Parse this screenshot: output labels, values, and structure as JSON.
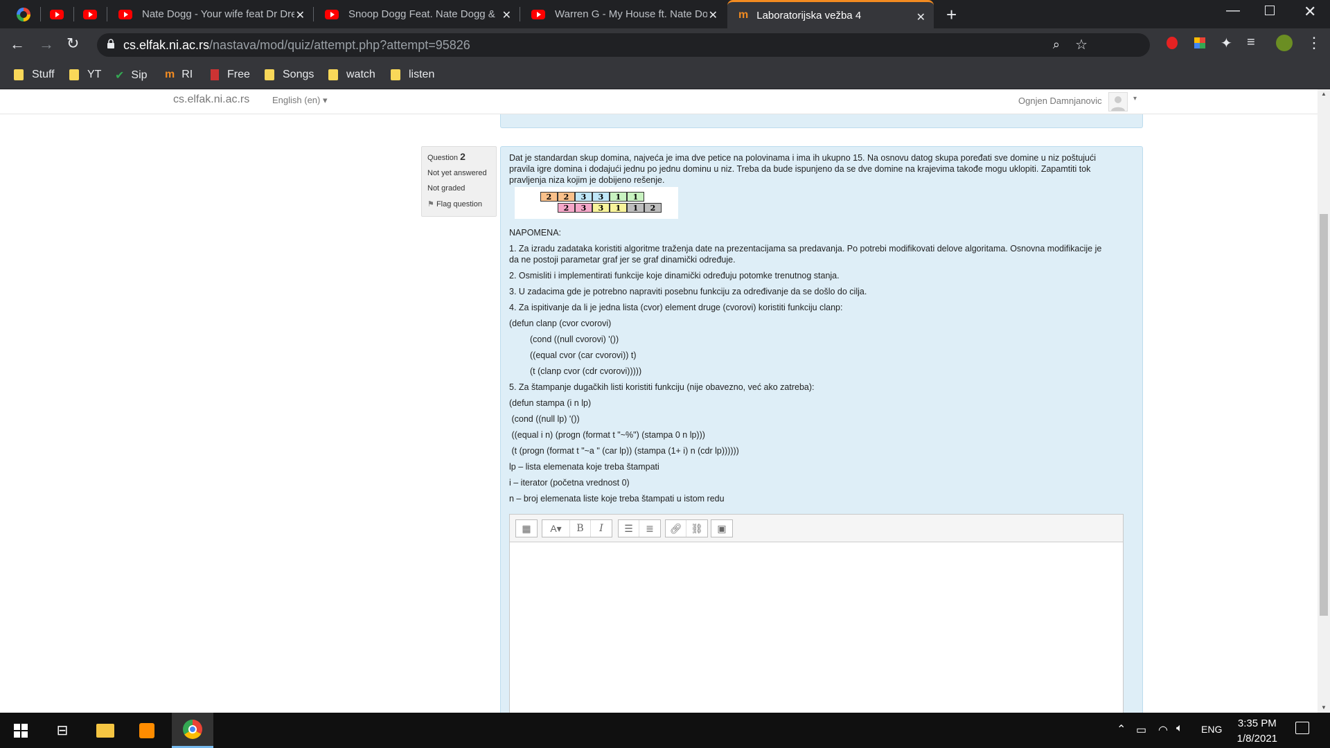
{
  "browser": {
    "tabs": [
      {
        "title": "Nate Dogg - Your wife feat Dr Dre"
      },
      {
        "title": "Snoop Dogg Feat. Nate Dogg & "
      },
      {
        "title": "Warren G - My House ft. Nate Dogg"
      },
      {
        "title": "Laboratorijska vežba 4",
        "active": true
      }
    ],
    "new_tab": "+",
    "url_domain": "cs.elfak.ni.ac.rs",
    "url_path": "/nastava/mod/quiz/attempt.php?attempt=95826",
    "bookmarks": [
      "Stuff",
      "YT",
      "Sip",
      "RI",
      "Free",
      "Songs",
      "watch",
      "listen"
    ]
  },
  "site": {
    "brand": "cs.elfak.ni.ac.rs",
    "language": "English (en)",
    "user": "Ognjen Damnjanovic"
  },
  "question": {
    "label": "Question",
    "number": "2",
    "status": "Not yet answered",
    "grade": "Not graded",
    "flag": "Flag question",
    "intro": "Dat je standardan skup domina, najveća je ima dve petice na polovinama i ima ih ukupno 15. Na osnovu datog skupa poređati sve domine u niz poštujući pravila igre domina i dodajući jednu po jednu dominu u niz. Treba da bude ispunjeno da se dve domine na krajevima takođe mogu uklopiti. Zapamtiti tok pravljenja niza kojim je dobijeno rešenje.",
    "dominoes_top": [
      "2",
      "2",
      "3",
      "3",
      "1",
      "1"
    ],
    "dominoes_bottom": [
      "2",
      "3",
      "3",
      "1",
      "1",
      "2"
    ],
    "note_title": "NAPOMENA:",
    "lines": [
      "1. Za izradu zadataka koristiti algoritme traženja date na prezentacijama sa predavanja. Po potrebi modifikovati delove algoritama. Osnovna modifikacije je da ne postoji parametar graf jer se graf dinamički određuje.",
      "2. Osmisliti i implementirati funkcije koje dinamički određuju potomke trenutnog stanja.",
      "3. U zadacima gde je potrebno napraviti posebnu funkciju za određivanje da se došlo do cilja.",
      "4. Za ispitivanje da li je jedna lista (cvor) element druge (cvorovi) koristiti funkciju clanp:",
      "(defun clanp (cvor cvorovi)",
      "(cond ((null cvorovi) '())",
      "((equal cvor (car cvorovi)) t)",
      "(t (clanp cvor (cdr cvorovi)))))",
      "5. Za štampanje dugačkih listi koristiti funkciju (nije obavezno, već ako zatreba):",
      "(defun stampa (i n lp)",
      " (cond ((null lp) '())",
      " ((equal i n) (progn (format t \"~%\") (stampa 0 n lp)))",
      " (t (progn (format t \"~a \" (car lp)) (stampa (1+ i) n (cdr lp))))))",
      "lp – lista elemenata koje treba štampati",
      "i – iterator (početna vrednost 0)",
      "n – broj elemenata liste koje treba štampati u istom redu"
    ]
  },
  "taskbar": {
    "lang": "ENG",
    "time": "3:35 PM",
    "date": "1/8/2021"
  }
}
